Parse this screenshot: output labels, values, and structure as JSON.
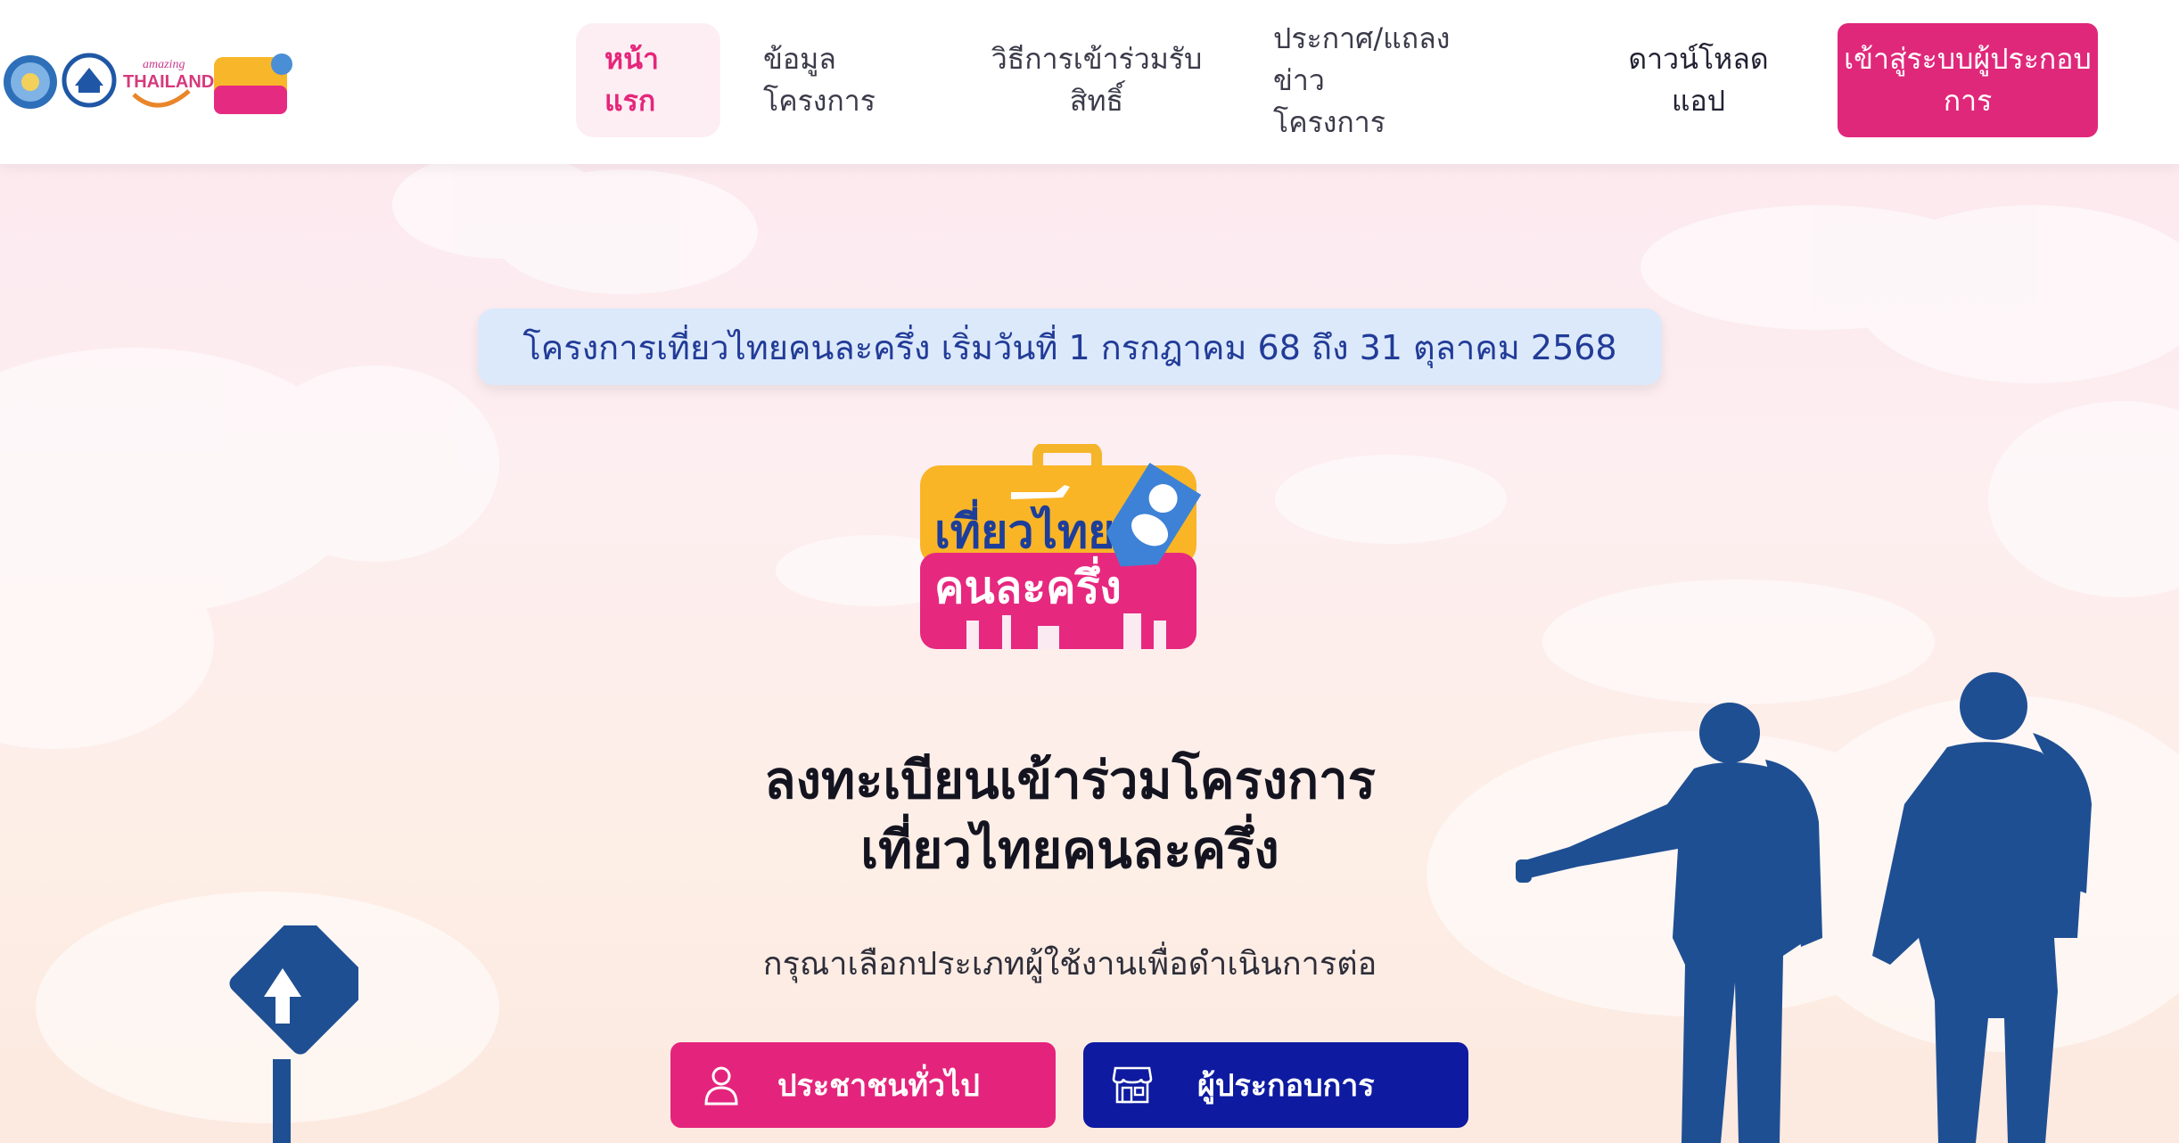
{
  "header": {
    "logos": [
      {
        "name": "ministry-seal-icon"
      },
      {
        "name": "agency-emblem-icon"
      },
      {
        "name": "amazing-thailand-logo",
        "small": "amazing",
        "big": "THAILAND"
      },
      {
        "name": "tiew-thai-small-logo"
      }
    ],
    "nav": {
      "home_l1": "หน้า",
      "home_l2": "แรก",
      "info_l1": "ข้อมูล",
      "info_l2": "โครงการ",
      "howto_l1": "วิธีการเข้าร่วมรับ",
      "howto_l2": "สิทธิ์",
      "news_l1": "ประกาศ/แถลงข่าว",
      "news_l2": "โครงการ",
      "download_l1": "ดาวน์โหลด",
      "download_l2": "แอป",
      "login_l1": "เข้าสู่ระบบผู้ประกอบ",
      "login_l2": "การ"
    }
  },
  "announcement": "โครงการเที่ยวไทยคนละครึ่ง เริ่มวันที่ 1 กรกฎาคม 68 ถึง 31 ตุลาคม 2568",
  "project_logo": {
    "line1": "เที่ยวไทย",
    "line2": "คนละครึ่ง"
  },
  "headline": {
    "line1": "ลงทะเบียนเข้าร่วมโครงการ",
    "line2": "เที่ยวไทยคนละครึ่ง"
  },
  "subtitle": "กรุณาเลือกประเภทผู้ใช้งานเพื่อดำเนินการต่อ",
  "buttons": {
    "citizen": {
      "label": "ประชาชนทั่วไป",
      "icon": "person-icon"
    },
    "merchant": {
      "label": "ผู้ประกอบการ",
      "icon": "store-icon"
    }
  },
  "colors": {
    "brand_pink": "#e0287b",
    "brand_navy": "#0e1aa0",
    "silhouette_blue": "#1f4f93",
    "announce_bg": "#dbe9fb"
  }
}
